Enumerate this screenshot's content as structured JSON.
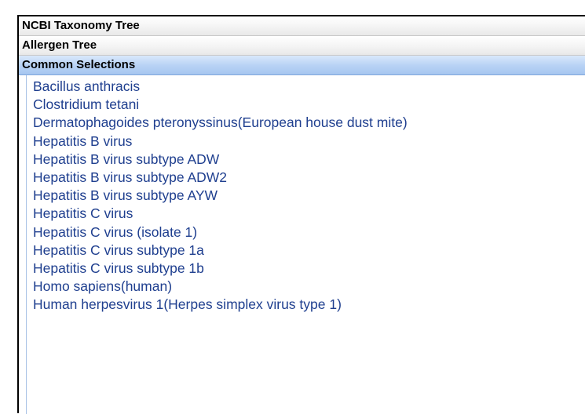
{
  "accordion": {
    "headers": [
      {
        "label": "NCBI Taxonomy Tree",
        "state": "collapsed"
      },
      {
        "label": "Allergen Tree",
        "state": "collapsed"
      },
      {
        "label": "Common Selections",
        "state": "expanded"
      }
    ],
    "common_selections": [
      "Bacillus anthracis",
      "Clostridium tetani",
      "Dermatophagoides pteronyssinus(European house dust mite)",
      "Hepatitis B virus",
      "Hepatitis B virus subtype ADW",
      "Hepatitis B virus subtype ADW2",
      "Hepatitis B virus subtype AYW",
      "Hepatitis C virus",
      "Hepatitis C virus (isolate 1)",
      "Hepatitis C virus subtype 1a",
      "Hepatitis C virus subtype 1b",
      "Homo sapiens(human)",
      "Human herpesvirus 1(Herpes simplex virus type 1)"
    ]
  },
  "colors": {
    "link_text": "#1f3f8f",
    "active_header": "#b9d3f5",
    "frame_border": "#000000"
  }
}
